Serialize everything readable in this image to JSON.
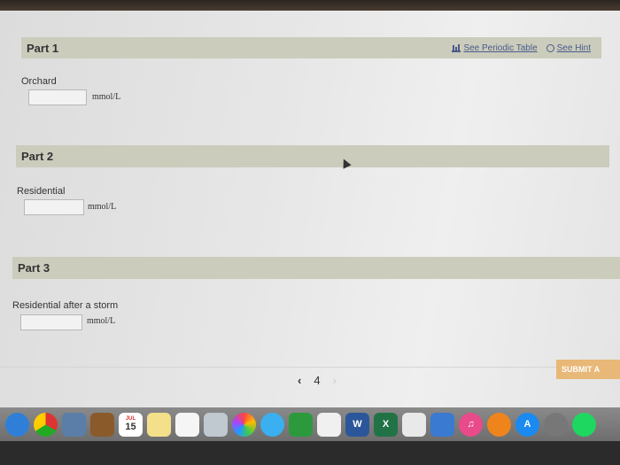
{
  "header": {
    "periodic_table_link": "See Periodic Table",
    "hint_link": "See Hint"
  },
  "parts": [
    {
      "title": "Part 1",
      "label": "Orchard",
      "unit": "mmol/L",
      "value": ""
    },
    {
      "title": "Part 2",
      "label": "Residential",
      "unit": "mmol/L",
      "value": ""
    },
    {
      "title": "Part 3",
      "label": "Residential after a storm",
      "unit": "mmol/L",
      "value": ""
    }
  ],
  "footer": {
    "submit_label": "SUBMIT A",
    "page_number": "4",
    "prev_symbol": "‹",
    "next_symbol": "›"
  },
  "dock": {
    "calendar_day": "15",
    "calendar_month": "JUL",
    "icons": [
      "safari-icon",
      "chrome-icon",
      "preview-icon",
      "notebook-icon",
      "calendar-icon",
      "notes-icon",
      "reminders-icon",
      "photos-booth-icon",
      "photos-icon",
      "messages-icon",
      "facetime-icon",
      "sketch-icon",
      "word-icon",
      "excel-icon",
      "numbers-icon",
      "keynote-icon",
      "itunes-icon",
      "ibooks-icon",
      "app-store-icon",
      "system-preferences-icon",
      "spotify-icon"
    ]
  }
}
